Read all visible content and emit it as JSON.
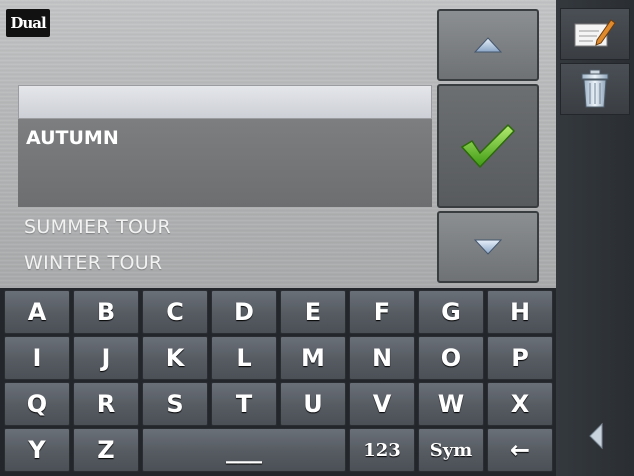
{
  "brand": {
    "logo_text": "Dual"
  },
  "input": {
    "value": ""
  },
  "list": {
    "selected": "AUTUMN",
    "items": [
      "SUMMER TOUR",
      "WINTER TOUR"
    ]
  },
  "controls": {
    "scroll_up_icon": "triangle-up-icon",
    "confirm_icon": "green-checkmark-icon",
    "scroll_down_icon": "triangle-down-icon"
  },
  "keyboard": {
    "rows": [
      [
        "A",
        "B",
        "C",
        "D",
        "E",
        "F",
        "G",
        "H"
      ],
      [
        "I",
        "J",
        "K",
        "L",
        "M",
        "N",
        "O",
        "P"
      ],
      [
        "Q",
        "R",
        "S",
        "T",
        "U",
        "V",
        "W",
        "X"
      ],
      [
        "Y",
        "Z"
      ]
    ],
    "space_label": "___",
    "numbers_label": "123",
    "symbols_label": "Sym",
    "backspace_label": "←"
  },
  "sidebar": {
    "edit_icon": "edit-note-icon",
    "delete_icon": "trash-icon",
    "back_icon": "triangle-left-icon"
  },
  "colors": {
    "accent_check": "#5cbf2a",
    "key_bg": "#565b62"
  }
}
